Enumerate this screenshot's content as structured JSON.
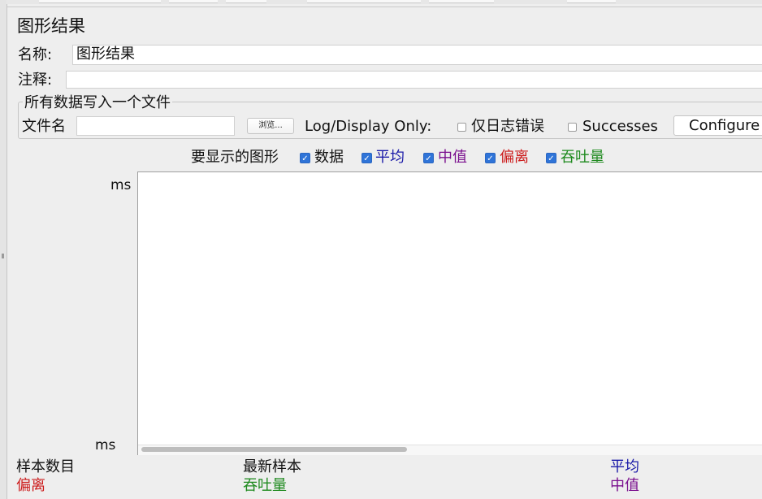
{
  "panel": {
    "title": "图形结果"
  },
  "name_row": {
    "label": "名称:",
    "value": "图形结果"
  },
  "comment_row": {
    "label": "注释:",
    "value": ""
  },
  "file_group": {
    "legend": "所有数据写入一个文件",
    "filename_label": "文件名",
    "filename_value": "",
    "browse_label": "浏览...",
    "log_display_label": "Log/Display Only:",
    "errors_only_label": "仅日志错误",
    "errors_only_checked": false,
    "successes_label": "Successes",
    "successes_checked": false,
    "configure_label": "Configure"
  },
  "graph_options": {
    "label": "要显示的图形",
    "items": [
      {
        "label": "数据",
        "checked": true,
        "color": "#111111"
      },
      {
        "label": "平均",
        "checked": true,
        "color": "#1a1aa8"
      },
      {
        "label": "中值",
        "checked": true,
        "color": "#7a0f8e"
      },
      {
        "label": "偏离",
        "checked": true,
        "color": "#cc1a1a"
      },
      {
        "label": "吞吐量",
        "checked": true,
        "color": "#1f8a1f"
      }
    ]
  },
  "graph": {
    "y_top_label": "ms",
    "y_bottom_label": "ms"
  },
  "stats": {
    "row1": [
      {
        "label": "样本数目",
        "color": "#111111"
      },
      {
        "label": "最新样本",
        "color": "#111111"
      },
      {
        "label": "平均",
        "color": "#1a1aa8"
      }
    ],
    "row2": [
      {
        "label": "偏离",
        "color": "#cc1a1a"
      },
      {
        "label": "吞吐量",
        "color": "#1f8a1f"
      },
      {
        "label": "中值",
        "color": "#7a0f8e"
      }
    ]
  },
  "colors": {
    "background": "#eeeeee",
    "checkbox_checked": "#2f74d8",
    "graph_background": "#ffffff"
  }
}
